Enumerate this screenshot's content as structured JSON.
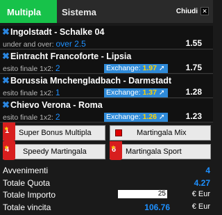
{
  "tabs": {
    "active": "Multipla",
    "other": "Sistema"
  },
  "close": {
    "label": "Chiudi",
    "icon": "✕"
  },
  "bets": [
    {
      "match": "Ingolstadt - Schalke 04",
      "market": "under and over:",
      "pick": "over 2.5",
      "exchange_label": "",
      "exchange_value": "",
      "odd": "1.55"
    },
    {
      "match": "Eintracht Francoforte - Lipsia",
      "market": "esito finale 1x2:",
      "pick": "2",
      "exchange_label": "Exchange:",
      "exchange_value": "1.97",
      "odd": "1.75"
    },
    {
      "match": "Borussia Mnchengladbach - Darmstadt",
      "market": "esito finale 1x2:",
      "pick": "1",
      "exchange_label": "Exchange:",
      "exchange_value": "1.37",
      "odd": "1.28"
    },
    {
      "match": "Chievo Verona - Roma",
      "market": "esito finale 1x2:",
      "pick": "2",
      "exchange_label": "Exchange:",
      "exchange_value": "1.26",
      "odd": "1.23"
    }
  ],
  "promos": {
    "super_bonus": {
      "badge": "1",
      "label": "Super Bonus Multipla"
    },
    "mix": {
      "label": "Martingala Mix"
    },
    "speedy": {
      "badge": "4",
      "label": "Speedy Martingala"
    },
    "sport": {
      "badge": "6",
      "label": "Martingala Sport"
    }
  },
  "summary": {
    "avvenimenti_label": "Avvenimenti",
    "avvenimenti_value": "4",
    "quota_label": "Totale Quota",
    "quota_value": "4.27",
    "importo_label": "Totale Importo",
    "importo_value": "25",
    "importo_unit": "€ Eur",
    "vincita_label": "Totale vincita",
    "vincita_value": "106.76",
    "vincita_unit": "€ Eur"
  },
  "colors": {
    "accent_green": "#17c24a",
    "link_blue": "#1e90ff",
    "exchange_bg": "#2e8ad8",
    "badge_red": "#d81e1e"
  }
}
